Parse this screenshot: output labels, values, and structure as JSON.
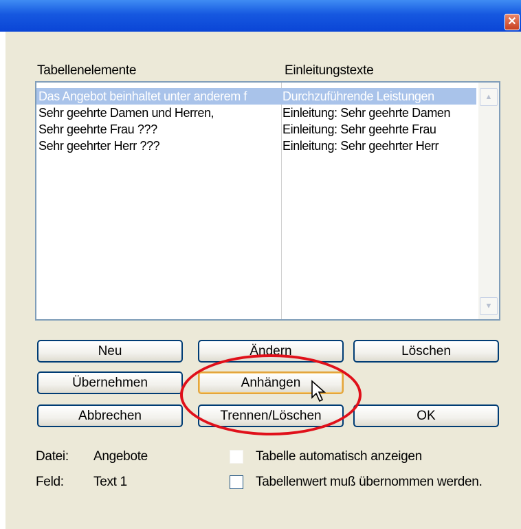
{
  "window": {
    "close_glyph": "✕"
  },
  "columns": {
    "left_header": "Tabellenelemente",
    "right_header": "Einleitungstexte"
  },
  "rows": [
    {
      "element": "Das Angebot beinhaltet unter anderem f",
      "intro": "Durchzuführende Leistungen",
      "selected": true
    },
    {
      "element": "Sehr geehrte Damen und Herren,",
      "intro": "Einleitung: Sehr geehrte Damen",
      "selected": false
    },
    {
      "element": "Sehr geehrte Frau ???",
      "intro": "Einleitung: Sehr geehrte Frau",
      "selected": false
    },
    {
      "element": "Sehr geehrter Herr ???",
      "intro": "Einleitung: Sehr geehrter Herr",
      "selected": false
    }
  ],
  "buttons": {
    "neu": "Neu",
    "aendern": "Ändern",
    "loeschen": "Löschen",
    "uebernehmen": "Übernehmen",
    "anhaengen": "Anhängen",
    "abbrechen": "Abbrechen",
    "trennen": "Trennen/Löschen",
    "ok": "OK"
  },
  "info": {
    "datei_label": "Datei:",
    "datei_value": "Angebote",
    "feld_label": "Feld:",
    "feld_value": "Text 1"
  },
  "options": {
    "auto_show": {
      "label": "Tabelle automatisch anzeigen",
      "checked": false
    },
    "must_accept": {
      "label": "Tabellenwert muß übernommen werden.",
      "checked": false
    }
  },
  "colors": {
    "annotation": "#e0101a",
    "selection": "#a9c3ea",
    "titlebar": "#0a45d6"
  }
}
